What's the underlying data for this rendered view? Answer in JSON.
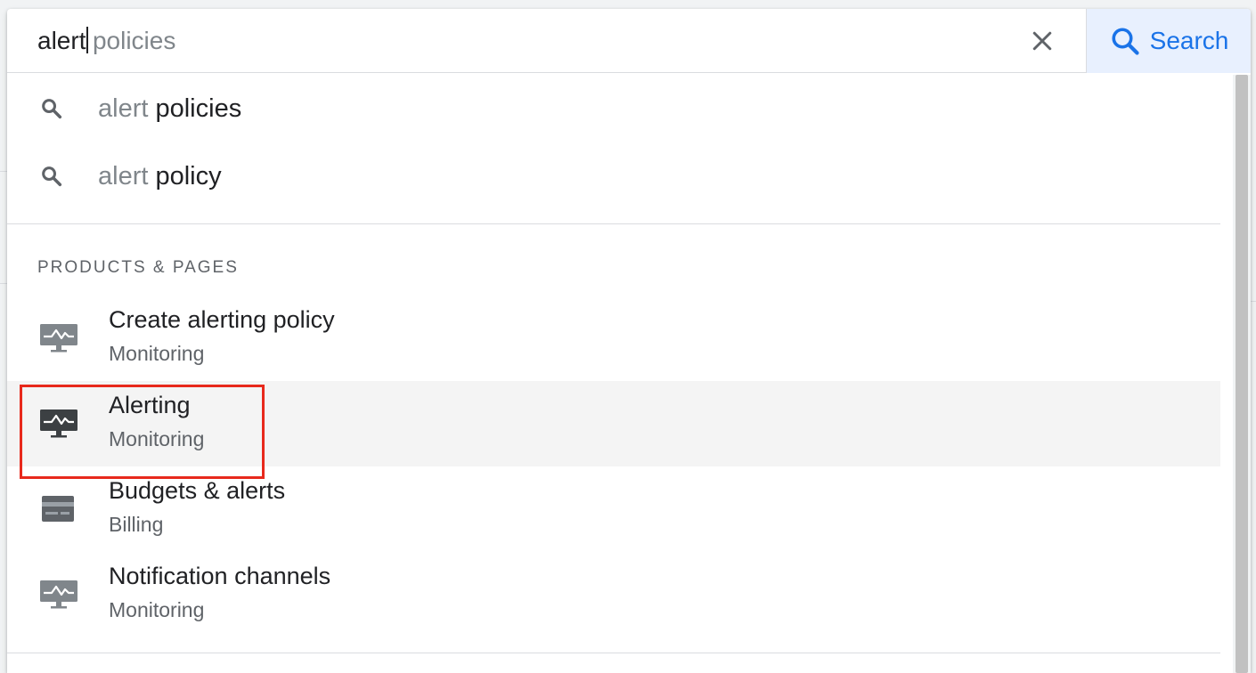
{
  "search": {
    "typed_text": "alert",
    "autocomplete_hint": "policies",
    "clear_icon": "close-icon",
    "button_label": "Search",
    "button_icon": "search-icon"
  },
  "suggestions": [
    {
      "prefix": "alert",
      "completion": "policies",
      "icon": "search-icon"
    },
    {
      "prefix": "alert",
      "completion": "policy",
      "icon": "search-icon"
    }
  ],
  "section": {
    "heading": "PRODUCTS & PAGES"
  },
  "results": [
    {
      "title": "Create alerting policy",
      "subtitle": "Monitoring",
      "icon": "monitoring-icon"
    },
    {
      "title": "Alerting",
      "subtitle": "Monitoring",
      "icon": "monitoring-icon",
      "selected": true
    },
    {
      "title": "Budgets & alerts",
      "subtitle": "Billing",
      "icon": "billing-icon"
    },
    {
      "title": "Notification channels",
      "subtitle": "Monitoring",
      "icon": "monitoring-icon"
    }
  ],
  "colors": {
    "accent": "#1a73e8",
    "search_button_bg": "#e8f0fe",
    "highlight_border": "#e8291c",
    "selected_row_bg": "#f4f4f4"
  }
}
